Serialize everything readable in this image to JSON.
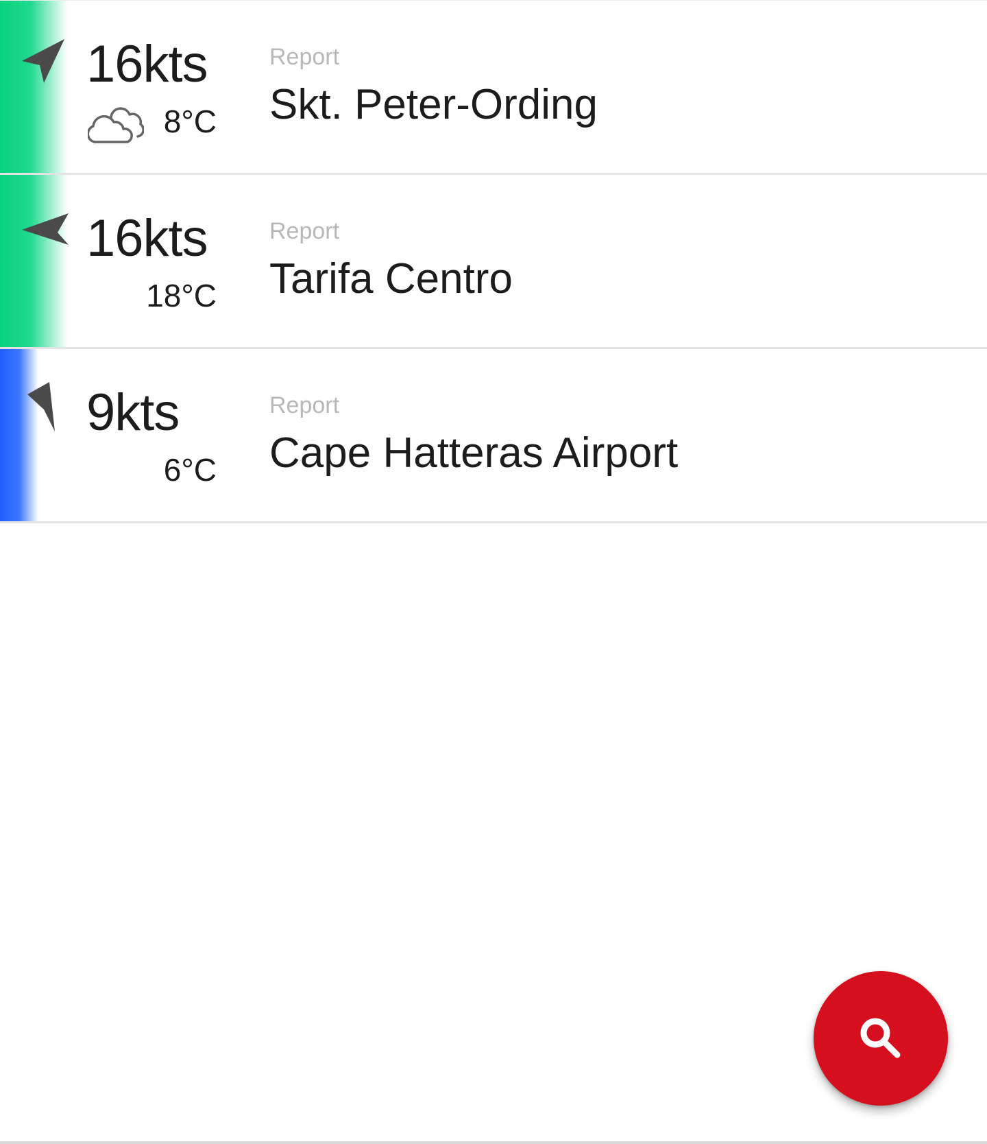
{
  "spots": [
    {
      "wind_speed": "16kts",
      "temperature": "8°C",
      "type_label": "Report",
      "name": "Skt. Peter-Ording",
      "weather_icon": "cloudy-icon",
      "wind_arrow_icon": "navigation-arrow-icon",
      "strip_color": "#08d27e"
    },
    {
      "wind_speed": "16kts",
      "temperature": "18°C",
      "type_label": "Report",
      "name": "Tarifa Centro",
      "wind_arrow_icon": "navigation-arrow-icon",
      "strip_color": "#08d27e"
    },
    {
      "wind_speed": "9kts",
      "temperature": "6°C",
      "type_label": "Report",
      "name": "Cape Hatteras Airport",
      "wind_arrow_icon": "navigation-arrow-icon",
      "strip_color": "#1f5dff"
    }
  ],
  "fab": {
    "icon": "search-icon",
    "color": "#d50f1e"
  }
}
